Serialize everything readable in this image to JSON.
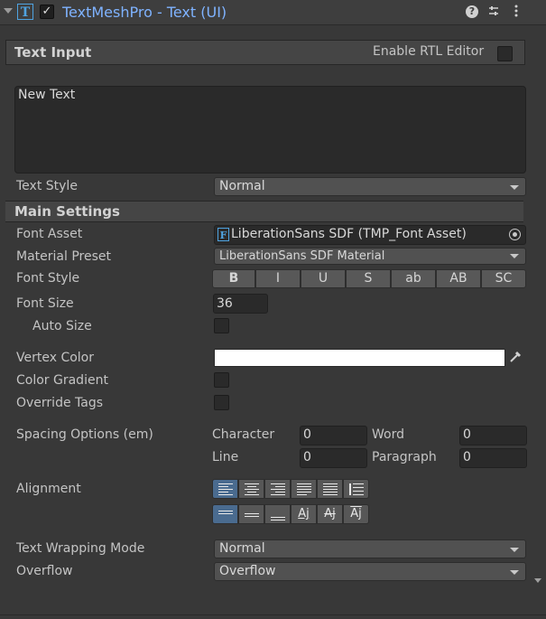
{
  "header": {
    "title": "TextMeshPro - Text (UI)",
    "tmp_icon_letter": "T",
    "enabled_check": "✓"
  },
  "text_input": {
    "section_title": "Text Input",
    "rtl_label": "Enable RTL Editor",
    "text_value": "New Text",
    "text_style_label": "Text Style",
    "text_style_value": "Normal"
  },
  "main_settings": {
    "section_title": "Main Settings",
    "font_asset_label": "Font Asset",
    "font_asset_icon_letter": "F",
    "font_asset_value": "LiberationSans SDF (TMP_Font Asset)",
    "material_preset_label": "Material Preset",
    "material_preset_value": "LiberationSans SDF Material",
    "font_style_label": "Font Style",
    "font_style_buttons": [
      "B",
      "I",
      "U",
      "S",
      "ab",
      "AB",
      "SC"
    ],
    "font_size_label": "Font Size",
    "font_size_value": "36",
    "auto_size_label": "Auto Size",
    "vertex_color_label": "Vertex Color",
    "vertex_color": "#ffffff",
    "color_gradient_label": "Color Gradient",
    "override_tags_label": "Override Tags",
    "spacing_label": "Spacing Options (em)",
    "spacing": {
      "character_label": "Character",
      "character_value": "0",
      "word_label": "Word",
      "word_value": "0",
      "line_label": "Line",
      "line_value": "0",
      "paragraph_label": "Paragraph",
      "paragraph_value": "0"
    },
    "alignment_label": "Alignment",
    "horizontal_alignment": [
      "left",
      "center",
      "right",
      "justified",
      "flush",
      "geometry-center"
    ],
    "horizontal_selected": "left",
    "vertical_alignment": [
      "top",
      "middle",
      "bottom",
      "baseline",
      "midline",
      "capline"
    ],
    "vertical_selected": "top",
    "text_wrapping_label": "Text Wrapping Mode",
    "text_wrapping_value": "Normal",
    "overflow_label": "Overflow",
    "overflow_value": "Overflow"
  },
  "colors": {
    "accent_title": "#7fb3ff",
    "selected_button": "#4a6b8f",
    "background": "#383838"
  }
}
